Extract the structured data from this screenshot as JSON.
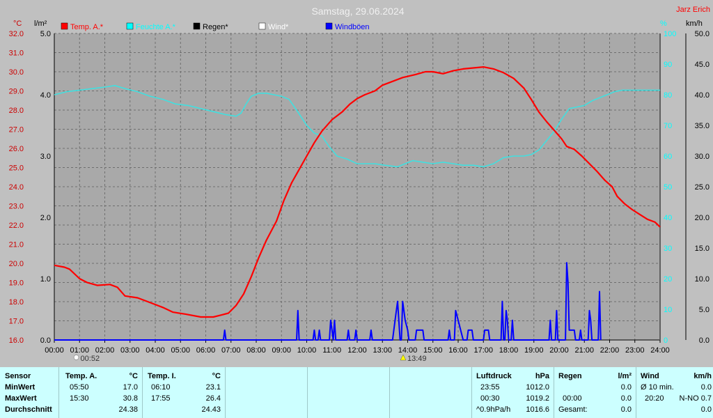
{
  "header": {
    "title": "Samstag, 29.06.2024",
    "author": "Jarz Erich",
    "unit_temp": "°C",
    "unit_rain": "l/m²",
    "unit_humidity": "%",
    "unit_wind": "km/h"
  },
  "legend": [
    {
      "label": "Temp. A.*",
      "color": "#ff0000"
    },
    {
      "label": "Feuchte A.*",
      "color": "#00ffff"
    },
    {
      "label": "Regen*",
      "color": "#000000"
    },
    {
      "label": "Wind*",
      "color": "#ffffff"
    },
    {
      "label": "Windböen",
      "color": "#0000ff"
    }
  ],
  "colors": {
    "background": "#c0c0c0",
    "plot_bg": "#a9a9a9",
    "temperature": "#ff0000",
    "temp_axis": "#cc0000",
    "humidity": "#40e0e0",
    "humidity_axis": "#00ffff",
    "gust": "#0000ff",
    "grid": "#6e6e6e",
    "panel": "#ccffff"
  },
  "markers": [
    {
      "time": "00:52",
      "x": 0.87,
      "icon": "moon-icon"
    },
    {
      "time": "13:49",
      "x": 13.82,
      "icon": "sun-icon"
    }
  ],
  "chart_data": {
    "type": "line",
    "title": "Samstag, 29.06.2024",
    "grid": true,
    "legend_position": "top-left",
    "x_ticks": [
      "00:00",
      "01:00",
      "02:00",
      "03:00",
      "04:00",
      "05:00",
      "06:00",
      "07:00",
      "08:00",
      "09:00",
      "10:00",
      "11:00",
      "12:00",
      "13:00",
      "14:00",
      "15:00",
      "16:00",
      "17:00",
      "18:00",
      "19:00",
      "20:00",
      "21:00",
      "22:00",
      "23:00",
      "24:00"
    ],
    "xlim": [
      0,
      24
    ],
    "axes": {
      "temperature": {
        "label": "°C",
        "range": [
          16,
          32
        ],
        "ticks": [
          "16.0",
          "17.0",
          "18.0",
          "19.0",
          "20.0",
          "21.0",
          "22.0",
          "23.0",
          "24.0",
          "25.0",
          "26.0",
          "27.0",
          "28.0",
          "29.0",
          "30.0",
          "31.0",
          "32.0"
        ]
      },
      "rain": {
        "label": "l/m²",
        "range": [
          0,
          5
        ],
        "ticks": [
          "0.0",
          "1.0",
          "2.0",
          "3.0",
          "4.0",
          "5.0"
        ]
      },
      "humidity": {
        "label": "%",
        "range": [
          0,
          100
        ],
        "ticks": [
          "0",
          "10",
          "20",
          "30",
          "40",
          "50",
          "60",
          "70",
          "80",
          "90",
          "100"
        ]
      },
      "wind": {
        "label": "km/h",
        "range": [
          0,
          50
        ],
        "ticks": [
          "0.0",
          "5.0",
          "10.0",
          "15.0",
          "20.0",
          "25.0",
          "30.0",
          "35.0",
          "40.0",
          "45.0",
          "50.0"
        ]
      }
    },
    "series": [
      {
        "name": "Temp. A.*",
        "axis": "temperature",
        "points": [
          [
            0,
            19.9
          ],
          [
            0.4,
            19.8
          ],
          [
            0.6,
            19.7
          ],
          [
            1,
            19.2
          ],
          [
            1.3,
            19.0
          ],
          [
            1.7,
            18.85
          ],
          [
            2.2,
            18.9
          ],
          [
            2.5,
            18.75
          ],
          [
            2.8,
            18.3
          ],
          [
            3.3,
            18.2
          ],
          [
            3.8,
            17.95
          ],
          [
            4.3,
            17.7
          ],
          [
            4.7,
            17.45
          ],
          [
            5.2,
            17.35
          ],
          [
            5.8,
            17.2
          ],
          [
            6.3,
            17.2
          ],
          [
            6.6,
            17.3
          ],
          [
            6.9,
            17.4
          ],
          [
            7.2,
            17.8
          ],
          [
            7.5,
            18.4
          ],
          [
            7.8,
            19.3
          ],
          [
            8.1,
            20.3
          ],
          [
            8.4,
            21.2
          ],
          [
            8.8,
            22.2
          ],
          [
            9.1,
            23.3
          ],
          [
            9.4,
            24.2
          ],
          [
            9.7,
            24.9
          ],
          [
            10,
            25.6
          ],
          [
            10.3,
            26.3
          ],
          [
            10.6,
            26.9
          ],
          [
            11,
            27.5
          ],
          [
            11.4,
            27.9
          ],
          [
            11.7,
            28.3
          ],
          [
            12,
            28.6
          ],
          [
            12.3,
            28.8
          ],
          [
            12.7,
            29.0
          ],
          [
            13,
            29.3
          ],
          [
            13.4,
            29.5
          ],
          [
            13.8,
            29.7
          ],
          [
            14.3,
            29.85
          ],
          [
            14.7,
            30.0
          ],
          [
            15,
            30.0
          ],
          [
            15.4,
            29.9
          ],
          [
            15.8,
            30.05
          ],
          [
            16.2,
            30.15
          ],
          [
            16.6,
            30.2
          ],
          [
            17,
            30.25
          ],
          [
            17.4,
            30.15
          ],
          [
            17.8,
            29.95
          ],
          [
            18.2,
            29.65
          ],
          [
            18.6,
            29.15
          ],
          [
            18.9,
            28.55
          ],
          [
            19.2,
            27.9
          ],
          [
            19.5,
            27.4
          ],
          [
            19.8,
            26.95
          ],
          [
            20.1,
            26.5
          ],
          [
            20.3,
            26.1
          ],
          [
            20.6,
            25.95
          ],
          [
            20.9,
            25.6
          ],
          [
            21.2,
            25.2
          ],
          [
            21.5,
            24.8
          ],
          [
            21.8,
            24.35
          ],
          [
            22.1,
            24.0
          ],
          [
            22.3,
            23.5
          ],
          [
            22.6,
            23.1
          ],
          [
            22.9,
            22.8
          ],
          [
            23.2,
            22.55
          ],
          [
            23.5,
            22.3
          ],
          [
            23.8,
            22.15
          ],
          [
            24,
            21.9
          ]
        ]
      },
      {
        "name": "Feuchte A.*",
        "axis": "humidity",
        "points": [
          [
            0,
            80
          ],
          [
            0.5,
            81
          ],
          [
            1,
            81.5
          ],
          [
            1.5,
            82
          ],
          [
            2,
            82.5
          ],
          [
            2.4,
            83
          ],
          [
            2.8,
            82
          ],
          [
            3.3,
            81
          ],
          [
            3.8,
            79.5
          ],
          [
            4.3,
            78.5
          ],
          [
            4.8,
            77
          ],
          [
            5.3,
            76.5
          ],
          [
            5.8,
            75.5
          ],
          [
            6.3,
            74.5
          ],
          [
            6.8,
            73.5
          ],
          [
            7.2,
            73
          ],
          [
            7.4,
            74
          ],
          [
            7.6,
            77
          ],
          [
            7.8,
            79.5
          ],
          [
            8.1,
            80.5
          ],
          [
            8.4,
            80.5
          ],
          [
            8.7,
            80
          ],
          [
            9,
            79.5
          ],
          [
            9.3,
            78.5
          ],
          [
            9.6,
            75
          ],
          [
            10,
            70
          ],
          [
            10.3,
            67.5
          ],
          [
            10.6,
            66.5
          ],
          [
            10.9,
            63
          ],
          [
            11.2,
            60
          ],
          [
            11.6,
            59
          ],
          [
            12,
            57.5
          ],
          [
            12.3,
            57.5
          ],
          [
            12.7,
            57.5
          ],
          [
            13.1,
            57
          ],
          [
            13.6,
            56.5
          ],
          [
            13.9,
            57.5
          ],
          [
            14.2,
            58.5
          ],
          [
            14.6,
            58
          ],
          [
            15,
            57.5
          ],
          [
            15.4,
            58
          ],
          [
            15.8,
            57.5
          ],
          [
            16.2,
            57
          ],
          [
            16.6,
            57
          ],
          [
            17,
            56.5
          ],
          [
            17.4,
            57.5
          ],
          [
            17.8,
            59.5
          ],
          [
            18.2,
            60
          ],
          [
            18.6,
            60
          ],
          [
            18.9,
            60.5
          ],
          [
            19.2,
            62
          ],
          [
            19.5,
            65
          ],
          [
            19.8,
            68
          ],
          [
            20.1,
            72
          ],
          [
            20.4,
            75.5
          ],
          [
            20.7,
            76
          ],
          [
            21,
            76.5
          ],
          [
            21.3,
            78
          ],
          [
            21.6,
            79
          ],
          [
            21.9,
            80
          ],
          [
            22.2,
            81
          ],
          [
            22.5,
            81.5
          ],
          [
            23,
            81.5
          ],
          [
            23.5,
            81.5
          ],
          [
            24,
            81.5
          ]
        ]
      },
      {
        "name": "Windböen",
        "axis": "wind",
        "points": [
          [
            0,
            0
          ],
          [
            6.7,
            0
          ],
          [
            6.75,
            1.6
          ],
          [
            6.8,
            0
          ],
          [
            9.6,
            0
          ],
          [
            9.65,
            4.8
          ],
          [
            9.7,
            0
          ],
          [
            10.25,
            0
          ],
          [
            10.3,
            1.6
          ],
          [
            10.35,
            0
          ],
          [
            10.45,
            0
          ],
          [
            10.5,
            1.6
          ],
          [
            10.55,
            0
          ],
          [
            10.9,
            0
          ],
          [
            10.95,
            3.2
          ],
          [
            11.0,
            1.6
          ],
          [
            11.05,
            0
          ],
          [
            11.1,
            3.2
          ],
          [
            11.15,
            0
          ],
          [
            11.6,
            0
          ],
          [
            11.65,
            1.6
          ],
          [
            11.7,
            0
          ],
          [
            11.9,
            0
          ],
          [
            11.95,
            1.6
          ],
          [
            12.0,
            0
          ],
          [
            12.5,
            0
          ],
          [
            12.55,
            1.6
          ],
          [
            12.6,
            0
          ],
          [
            13.4,
            0
          ],
          [
            13.5,
            3.2
          ],
          [
            13.6,
            6.3
          ],
          [
            13.7,
            0
          ],
          [
            13.75,
            0
          ],
          [
            13.8,
            6.3
          ],
          [
            13.9,
            3.2
          ],
          [
            14.0,
            1.6
          ],
          [
            14.05,
            0
          ],
          [
            14.3,
            0
          ],
          [
            14.35,
            1.6
          ],
          [
            14.6,
            1.6
          ],
          [
            14.65,
            0
          ],
          [
            15.6,
            0
          ],
          [
            15.65,
            1.6
          ],
          [
            15.7,
            0
          ],
          [
            15.85,
            0
          ],
          [
            15.9,
            4.8
          ],
          [
            16.0,
            3.2
          ],
          [
            16.1,
            1.6
          ],
          [
            16.2,
            0
          ],
          [
            16.35,
            0
          ],
          [
            16.4,
            1.6
          ],
          [
            16.55,
            1.6
          ],
          [
            16.6,
            0
          ],
          [
            17.0,
            0
          ],
          [
            17.05,
            1.6
          ],
          [
            17.2,
            1.6
          ],
          [
            17.25,
            0
          ],
          [
            17.7,
            0
          ],
          [
            17.75,
            6.3
          ],
          [
            17.8,
            0
          ],
          [
            17.85,
            0
          ],
          [
            17.9,
            4.8
          ],
          [
            17.95,
            3.2
          ],
          [
            18.0,
            0
          ],
          [
            18.1,
            0
          ],
          [
            18.15,
            3.2
          ],
          [
            18.2,
            0
          ],
          [
            19.6,
            0
          ],
          [
            19.65,
            3.2
          ],
          [
            19.7,
            0
          ],
          [
            19.85,
            0
          ],
          [
            19.9,
            4.8
          ],
          [
            19.95,
            0
          ],
          [
            20.25,
            0
          ],
          [
            20.3,
            12.6
          ],
          [
            20.35,
            9.5
          ],
          [
            20.4,
            1.6
          ],
          [
            20.6,
            1.6
          ],
          [
            20.65,
            0
          ],
          [
            20.8,
            0
          ],
          [
            20.85,
            1.6
          ],
          [
            20.9,
            0
          ],
          [
            21.15,
            0
          ],
          [
            21.2,
            4.8
          ],
          [
            21.25,
            3.2
          ],
          [
            21.3,
            0
          ],
          [
            21.55,
            0
          ],
          [
            21.6,
            7.9
          ],
          [
            21.65,
            0
          ]
        ]
      }
    ]
  },
  "panels": {
    "sensor": {
      "title": "Sensor",
      "rows": [
        "MinWert",
        "MaxWert",
        "Durchschnitt"
      ]
    },
    "temp_a": {
      "title": "Temp. A.",
      "unit": "°C",
      "rows": [
        {
          "time": "05:50",
          "value": "17.0"
        },
        {
          "time": "15:30",
          "value": "30.8"
        },
        {
          "time": "",
          "value": "24.38"
        }
      ]
    },
    "temp_i": {
      "title": "Temp. I.",
      "unit": "°C",
      "rows": [
        {
          "time": "06:10",
          "value": "23.1"
        },
        {
          "time": "17:55",
          "value": "26.4"
        },
        {
          "time": "",
          "value": "24.43"
        }
      ]
    },
    "pressure": {
      "title": "Luftdruck",
      "unit": "hPa",
      "rows": [
        {
          "time": "23:55",
          "value": "1012.0"
        },
        {
          "time": "00:30",
          "value": "1019.2"
        },
        {
          "time": "^0.9hPa/h",
          "value": "1016.6"
        }
      ]
    },
    "rain": {
      "title": "Regen",
      "unit": "l/m²",
      "rows": [
        {
          "time": "",
          "value": "0.0"
        },
        {
          "time": "00:00",
          "value": "0.0"
        },
        {
          "time": "Gesamt:",
          "value": "0.0"
        }
      ]
    },
    "wind": {
      "title": "Wind",
      "unit": "km/h",
      "rows": [
        {
          "time": "Ø 10 min.",
          "value": "0.0"
        },
        {
          "time": "20:20",
          "value": "N-NO 0.7"
        },
        {
          "time": "",
          "value": "0.0"
        }
      ]
    }
  }
}
